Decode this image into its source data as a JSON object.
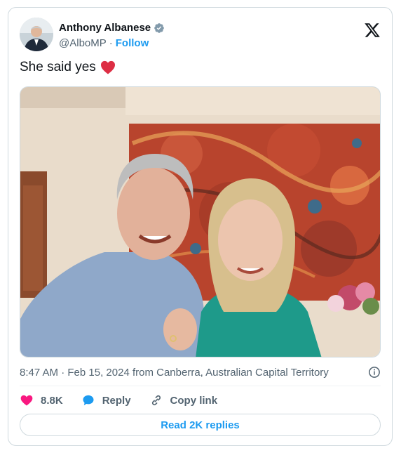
{
  "author": {
    "name": "Anthony Albanese",
    "handle": "@AlboMP",
    "separator": "·",
    "follow_label": "Follow"
  },
  "tweet": {
    "text": "She said yes",
    "emoji": "red-heart"
  },
  "meta": {
    "time": "8:47 AM",
    "separator": "·",
    "date": "Feb 15, 2024",
    "location": "from Canberra, Australian Capital Territory"
  },
  "actions": {
    "likes_count": "8.8K",
    "reply_label": "Reply",
    "copy_link_label": "Copy link"
  },
  "read_replies_label": "Read 2K replies",
  "colors": {
    "accent": "#1d9bf0",
    "like": "#f91880",
    "verified": "#829aab",
    "text_secondary": "#536471",
    "border": "#cfd9de"
  },
  "icons": {
    "verified": "verified-badge-icon",
    "platform": "x-logo-icon",
    "info": "info-icon",
    "like": "heart-icon",
    "reply": "reply-bubble-icon",
    "copy_link": "link-icon"
  }
}
